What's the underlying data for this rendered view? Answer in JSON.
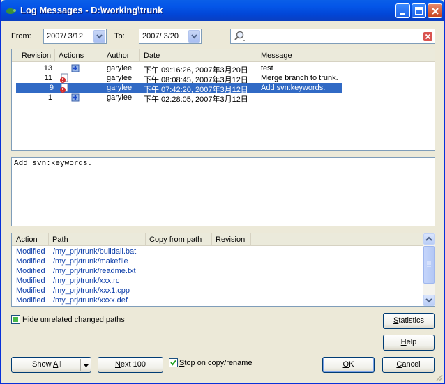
{
  "window": {
    "title": "Log Messages - D:\\working\\trunk"
  },
  "filters": {
    "from_label": "From:",
    "from_value": "2007/  3/12",
    "to_label": "To:",
    "to_value": "2007/  3/20",
    "search_value": ""
  },
  "log_table": {
    "columns": [
      "Revision",
      "Actions",
      "Author",
      "Date",
      "Message"
    ],
    "rows": [
      {
        "revision": "13",
        "author": "garylee",
        "date": "下午 09:16:26, 2007年3月20日",
        "message": "test",
        "action_icons": [
          "add-icon"
        ]
      },
      {
        "revision": "11",
        "author": "garylee",
        "date": "下午 08:08:45, 2007年3月12日",
        "message": "Merge branch to trunk.",
        "action_icons": [
          "modified-icon"
        ]
      },
      {
        "revision": "9",
        "author": "garylee",
        "date": "下午 07:42:20, 2007年3月12日",
        "message": "Add svn:keywords.",
        "action_icons": [
          "modified-icon"
        ],
        "selected": true
      },
      {
        "revision": "1",
        "author": "garylee",
        "date": "下午 02:28:05, 2007年3月12日",
        "message": "",
        "action_icons": [
          "add-icon"
        ]
      }
    ]
  },
  "message_box": {
    "text": "Add svn:keywords."
  },
  "changed_paths": {
    "columns": [
      "Action",
      "Path",
      "Copy from path",
      "Revision"
    ],
    "rows": [
      {
        "action": "Modified",
        "path": "/my_prj/trunk/buildall.bat"
      },
      {
        "action": "Modified",
        "path": "/my_prj/trunk/makefile"
      },
      {
        "action": "Modified",
        "path": "/my_prj/trunk/readme.txt"
      },
      {
        "action": "Modified",
        "path": "/my_prj/trunk/xxx.rc"
      },
      {
        "action": "Modified",
        "path": "/my_prj/trunk/xxx1.cpp"
      },
      {
        "action": "Modified",
        "path": "/my_prj/trunk/xxxx.def"
      }
    ]
  },
  "options": {
    "hide_unrelated_pre": "",
    "hide_unrelated_u": "H",
    "hide_unrelated_post": "ide unrelated changed paths",
    "hide_unrelated_checked": true,
    "stop_on_copy_pre": "",
    "stop_on_copy_u": "S",
    "stop_on_copy_post": "top on copy/rename",
    "stop_on_copy_checked": true
  },
  "buttons": {
    "statistics_u": "S",
    "statistics_post": "tatistics",
    "help_u": "H",
    "help_post": "elp",
    "show_all_pre": "Show ",
    "show_all_u": "A",
    "show_all_post": "ll",
    "next_100_u": "N",
    "next_100_post": "ext 100",
    "ok_u": "O",
    "ok_post": "K",
    "cancel_u": "C",
    "cancel_post": "ancel"
  },
  "colors": {
    "selection": "#316ac5",
    "link": "#0a3ca8",
    "accent": "#0831d9"
  }
}
